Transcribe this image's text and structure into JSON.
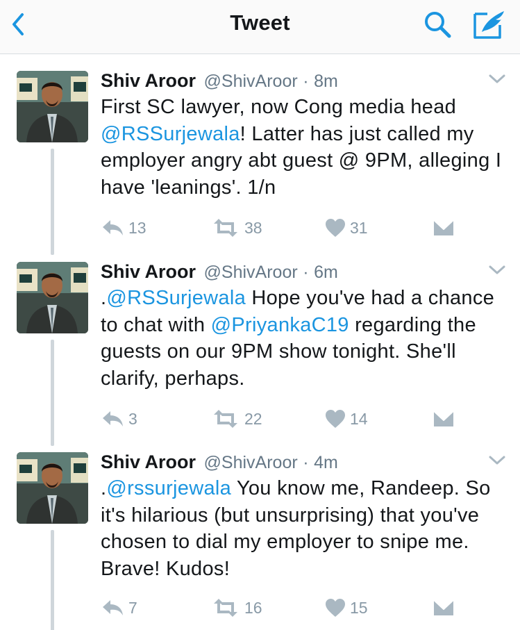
{
  "nav": {
    "title": "Tweet"
  },
  "colors": {
    "accent": "#1b95e0",
    "secondary_text": "#657786",
    "icon_gray": "#aab8c2"
  },
  "tweets": [
    {
      "name": "Shiv Aroor",
      "handle": "@ShivAroor",
      "dot": "·",
      "time": "8m",
      "text_parts": [
        {
          "text": "First SC lawyer, now Cong media head ",
          "mention": false
        },
        {
          "text": "@RSSurjewala",
          "mention": true
        },
        {
          "text": "! Latter has just called my employer angry abt guest @ 9PM, alleging I have 'leanings'. 1/n",
          "mention": false
        }
      ],
      "replies": "13",
      "retweets": "38",
      "likes": "31"
    },
    {
      "name": "Shiv Aroor",
      "handle": "@ShivAroor",
      "dot": "·",
      "time": "6m",
      "text_parts": [
        {
          "text": ".",
          "mention": false
        },
        {
          "text": "@RSSurjewala",
          "mention": true
        },
        {
          "text": " Hope you've had a chance to chat with ",
          "mention": false
        },
        {
          "text": "@PriyankaC19",
          "mention": true
        },
        {
          "text": " regarding the guests on our 9PM show tonight. She'll clarify, perhaps.",
          "mention": false
        }
      ],
      "replies": "3",
      "retweets": "22",
      "likes": "14"
    },
    {
      "name": "Shiv Aroor",
      "handle": "@ShivAroor",
      "dot": "·",
      "time": "4m",
      "text_parts": [
        {
          "text": ".",
          "mention": false
        },
        {
          "text": "@rssurjewala",
          "mention": true
        },
        {
          "text": " You know me, Randeep. So it's hilarious (but unsurprising) that you've chosen to dial my employer to snipe me. Brave! Kudos!",
          "mention": false
        }
      ],
      "replies": "7",
      "retweets": "16",
      "likes": "15"
    }
  ]
}
